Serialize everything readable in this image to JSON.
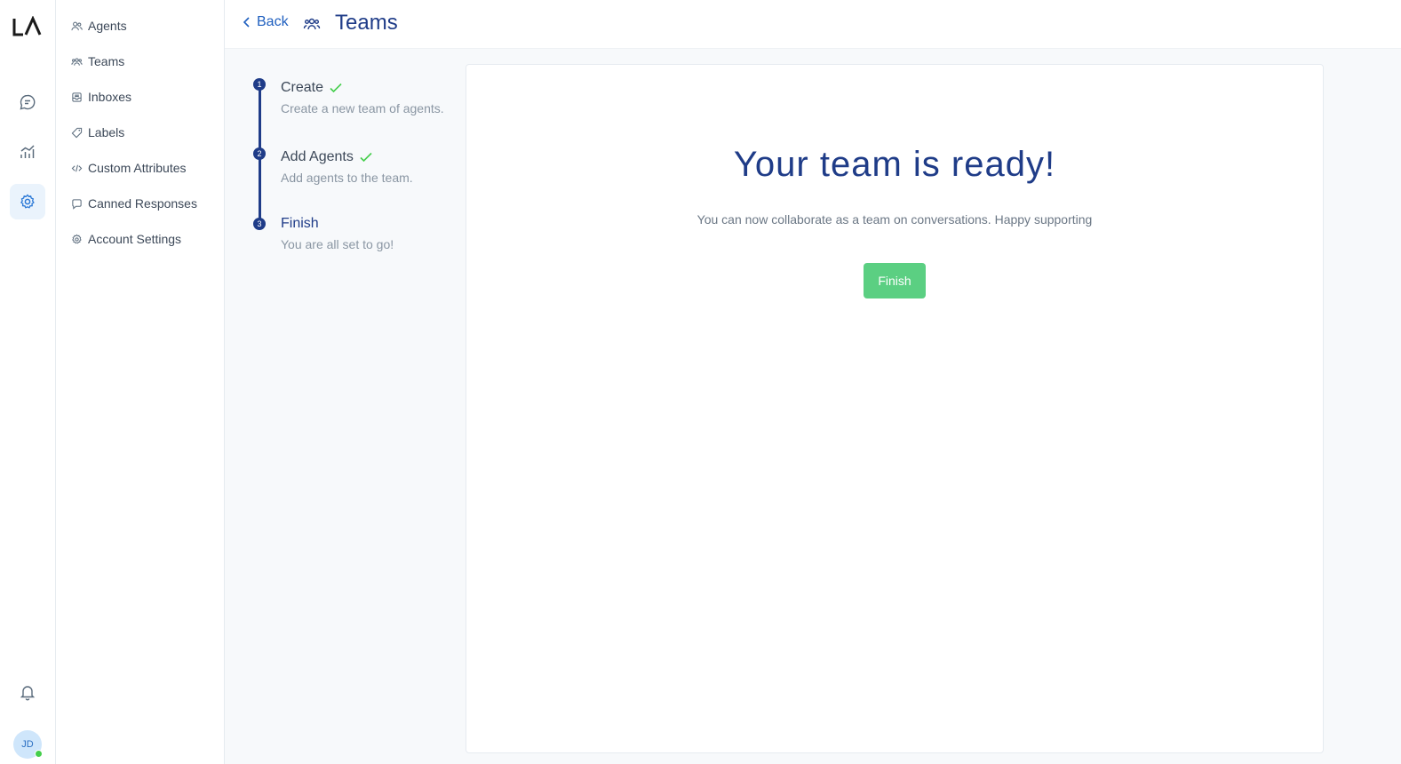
{
  "rail": {
    "logo_text": "LA",
    "items": [
      {
        "icon": "chat-icon",
        "active": false
      },
      {
        "icon": "reports-icon",
        "active": false
      },
      {
        "icon": "settings-icon",
        "active": true
      }
    ],
    "bell_icon": "bell-icon",
    "avatar_initials": "JD",
    "status_color": "#44ce4b"
  },
  "sidebar": {
    "items": [
      {
        "label": "Agents",
        "icon": "agents-icon"
      },
      {
        "label": "Teams",
        "icon": "teams-icon"
      },
      {
        "label": "Inboxes",
        "icon": "inbox-icon"
      },
      {
        "label": "Labels",
        "icon": "label-icon"
      },
      {
        "label": "Custom Attributes",
        "icon": "code-icon"
      },
      {
        "label": "Canned Responses",
        "icon": "chat-bubble-icon"
      },
      {
        "label": "Account Settings",
        "icon": "gear-icon"
      }
    ]
  },
  "header": {
    "back_label": "Back",
    "title": "Teams"
  },
  "steps": [
    {
      "number": "1",
      "title": "Create",
      "description": "Create a new team of agents.",
      "completed": true
    },
    {
      "number": "2",
      "title": "Add Agents",
      "description": "Add agents to the team.",
      "completed": true
    },
    {
      "number": "3",
      "title": "Finish",
      "description": "You are all set to go!",
      "completed": false
    }
  ],
  "content": {
    "headline": "Your team is ready!",
    "message": "You can now collaborate as a team on conversations. Happy supporting",
    "finish_label": "Finish"
  },
  "colors": {
    "primary": "#1f3c88",
    "link": "#1f5fbf",
    "success": "#5bcf82",
    "check": "#44ce4b"
  }
}
